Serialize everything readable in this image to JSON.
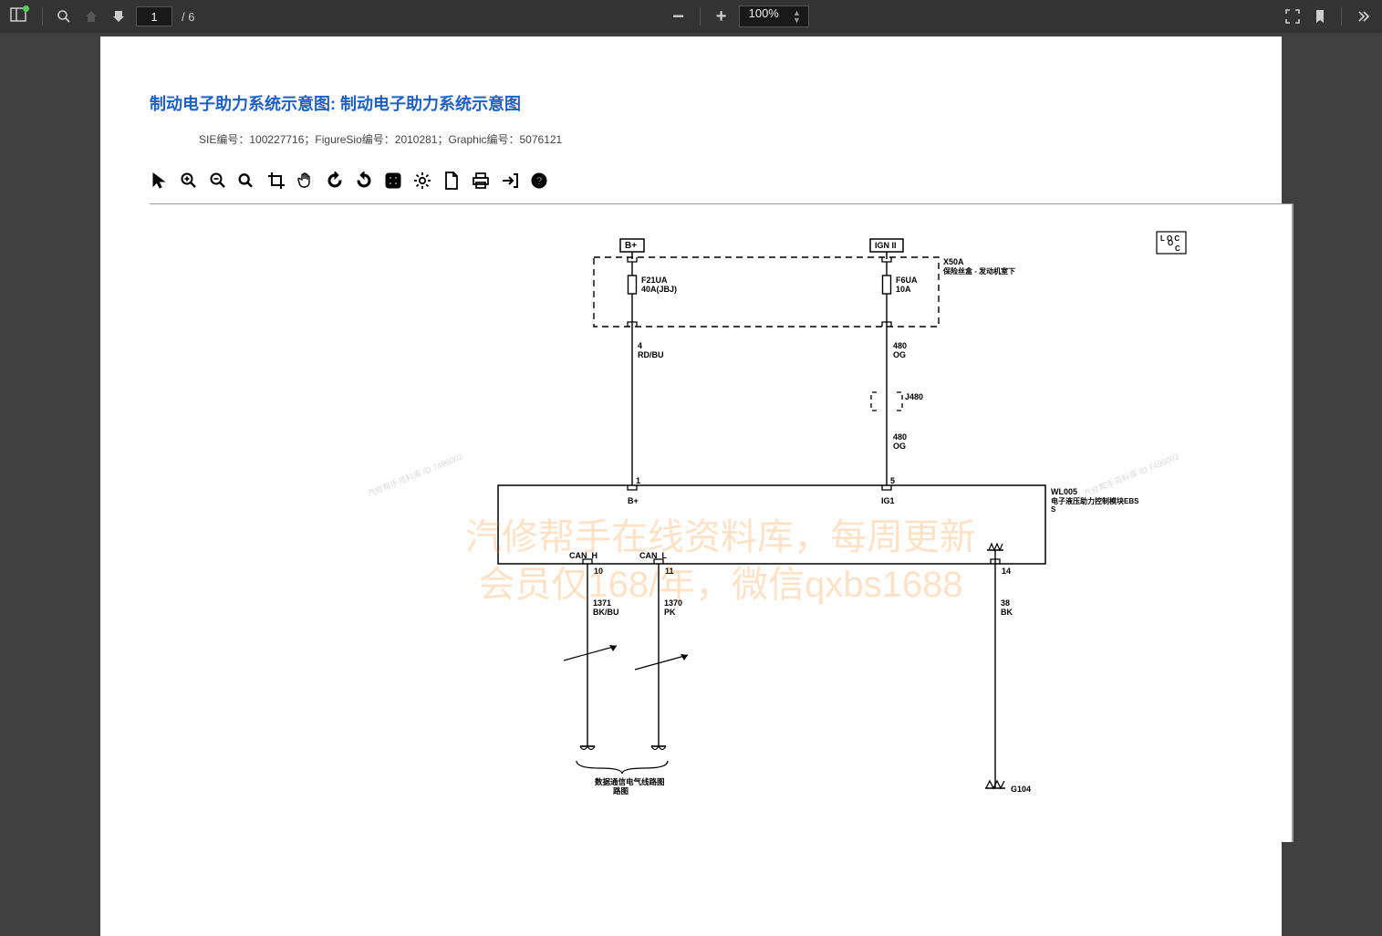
{
  "toolbar": {
    "page_current": "1",
    "page_total": "/ 6",
    "zoom_level": "100%"
  },
  "doc": {
    "title": "制动电子助力系统示意图: 制动电子助力系统示意图",
    "subline": "SIE编号：100227716；FigureSio编号：2010281；Graphic编号：5076121"
  },
  "diagram": {
    "top_bplus": "B+",
    "top_ign": "IGN II",
    "fuse1_line1": "F21UA",
    "fuse1_line2": "40A(JBJ)",
    "fuse2_line1": "F6UA",
    "fuse2_line2": "10A",
    "box_label_line1": "X50A",
    "box_label_line2": "保险丝盒 - 发动机室下",
    "wire1_line1": "4",
    "wire1_line2": "RD/BU",
    "wire2_line1": "480",
    "wire2_line2": "OG",
    "splice": "J480",
    "wire3_line1": "480",
    "wire3_line2": "OG",
    "pin1": "1",
    "pin5": "5",
    "module_bplus": "B+",
    "module_ig1": "IG1",
    "module_id": "WL005",
    "module_desc": "电子液压助力控制模块EBS",
    "can_h": "CAN_H",
    "can_l": "CAN_L",
    "pin10": "10",
    "pin11": "11",
    "pin14": "14",
    "wire4_line1": "1371",
    "wire4_line2": "BK/BU",
    "wire5_line1": "1370",
    "wire5_line2": "PK",
    "wire6_line1": "38",
    "wire6_line2": "BK",
    "bottom_label": "数据通信电气线路图",
    "ground": "G104",
    "loc": "L O C"
  },
  "watermark": {
    "line1": "汽修帮手在线资料库，每周更新",
    "line2": "会员仅168/年，微信qxbs1688",
    "small": "汽修帮手资料库 ID 7496002"
  }
}
